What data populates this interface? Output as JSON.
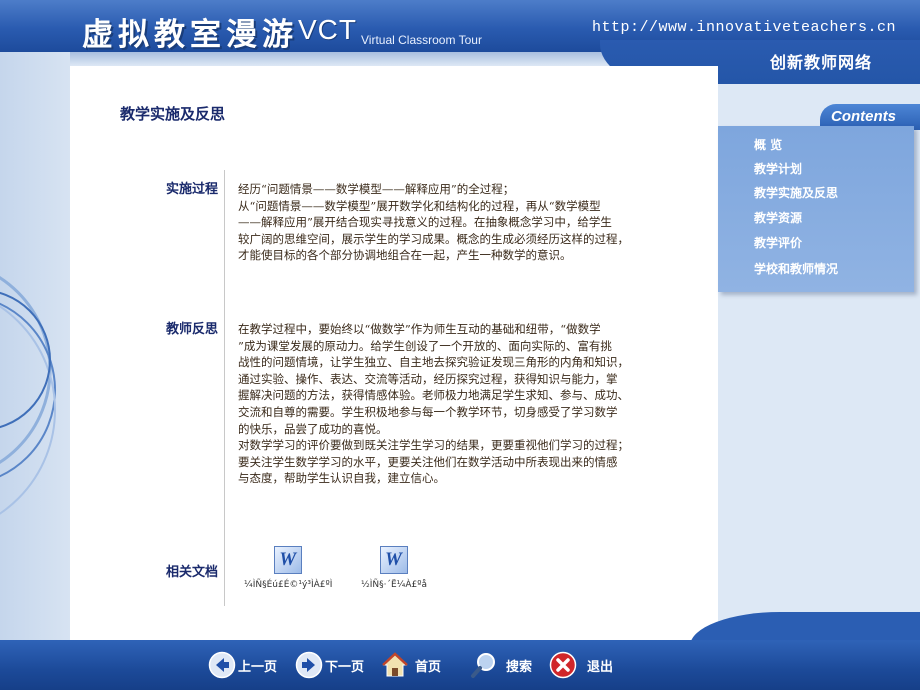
{
  "header": {
    "title_cn": "虚拟教室漫游",
    "title_en": "VCT",
    "subtitle": "Virtual Classroom Tour",
    "url": "http://www.innovativeteachers.cn",
    "site_name": "创新教师网络"
  },
  "page": {
    "heading": "教学实施及反思"
  },
  "sections": {
    "process": {
      "label": "实施过程",
      "text": "经历“问题情景——数学模型——解释应用”的全过程；\n从“问题情景——数学模型”展开数学化和结构化的过程，再从“数学模型\n——解释应用”展开结合现实寻找意义的过程。在抽象概念学习中，给学生\n较广阔的思维空间，展示学生的学习成果。概念的生成必须经历这样的过程，\n才能使目标的各个部分协调地组合在一起，产生一种数学的意识。"
    },
    "reflection": {
      "label": "教师反思",
      "text": "在教学过程中，要始终以“做数学”作为师生互动的基础和纽带，“做数学\n”成为课堂发展的原动力。给学生创设了一个开放的、面向实际的、富有挑\n战性的问题情境，让学生独立、自主地去探究验证发现三角形的内角和知识，\n通过实验、操作、表达、交流等活动，经历探究过程，获得知识与能力，掌\n握解决问题的方法，获得情感体验。老师极力地满足学生求知、参与、成功、\n交流和自尊的需要。学生积极地参与每一个教学环节，切身感受了学习数学\n的快乐，品尝了成功的喜悦。\n对数学学习的评价要做到既关注学生学习的结果，更要重视他们学习的过程；\n要关注学生数学学习的水平，更要关注他们在数学活动中所表现出来的情感\n与态度，帮助学生认识自我，建立信心。"
    },
    "documents": {
      "label": "相关文档",
      "items": [
        {
          "name": "¼ÌÑ§Éú£É©¹ý³ÌÀ£ºÌ",
          "icon": "word-document-icon"
        },
        {
          "name": "½ÌÑ§·´Ë¼À£ºå",
          "icon": "word-document-icon"
        }
      ]
    }
  },
  "menu": {
    "tab": "Contents",
    "items": [
      {
        "label": "概 览"
      },
      {
        "label": "教学计划"
      },
      {
        "label": "教学实施及反思"
      },
      {
        "label": "教学资源"
      },
      {
        "label": "教学评价"
      },
      {
        "label": "学校和教师情况"
      }
    ]
  },
  "footer": {
    "nav": [
      {
        "label": "上一页",
        "icon": "arrow-left-icon"
      },
      {
        "label": "下一页",
        "icon": "arrow-right-icon"
      },
      {
        "label": "首页",
        "icon": "home-icon"
      },
      {
        "label": "搜索",
        "icon": "search-icon"
      },
      {
        "label": "退出",
        "icon": "close-icon"
      }
    ]
  },
  "colors": {
    "header_blue": "#2a5bb0",
    "menu_blue": "#7ea6dd",
    "label_navy": "#1a2a6c",
    "exit_red": "#d0262a"
  }
}
